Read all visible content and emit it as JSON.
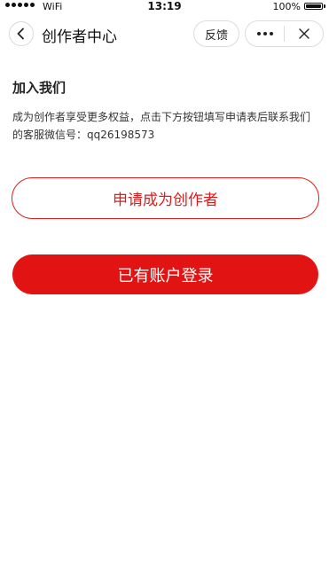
{
  "status_bar": {
    "carrier": "WiFi",
    "time": "13:19",
    "battery_percent": "100%",
    "battery_level": 1.0
  },
  "nav": {
    "title": "创作者中心",
    "feedback_label": "反馈",
    "back_icon": "chevron-left-icon",
    "more_icon": "more-dots-icon",
    "close_icon": "close-icon"
  },
  "content": {
    "section_title": "加入我们",
    "description": "成为创作者享受更多权益，点击下方按钮填写申请表后联系我们的客服微信号：qq26198573"
  },
  "actions": {
    "apply_label": "申请成为创作者",
    "login_label": "已有账户登录"
  },
  "colors": {
    "accent": "#e21313"
  }
}
